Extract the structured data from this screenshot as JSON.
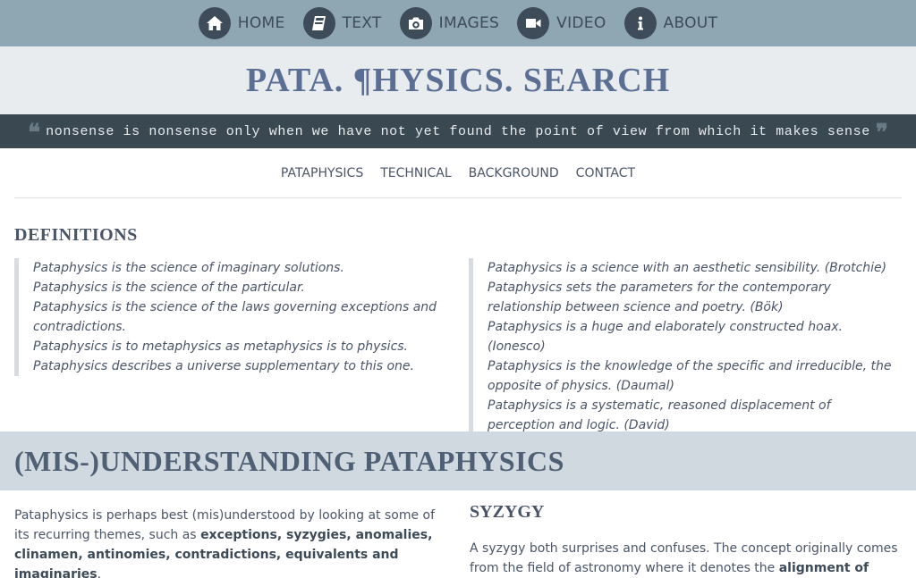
{
  "topnav": {
    "items": [
      {
        "label": "HOME",
        "icon": "home-icon"
      },
      {
        "label": "TEXT",
        "icon": "book-icon"
      },
      {
        "label": "IMAGES",
        "icon": "camera-icon"
      },
      {
        "label": "VIDEO",
        "icon": "video-camera-icon"
      },
      {
        "label": "ABOUT",
        "icon": "info-icon"
      }
    ]
  },
  "site": {
    "title": "PATA. ¶HYSICS. SEARCH"
  },
  "quote": {
    "text": "nonsense is nonsense only when we have not yet found the point of view from which it makes sense",
    "open": "❝",
    "close": "❞"
  },
  "subnav": {
    "items": [
      "PATAPHYSICS",
      "TECHNICAL",
      "BACKGROUND",
      "CONTACT"
    ]
  },
  "definitions": {
    "heading": "DEFINITIONS",
    "left": [
      "Pataphysics is the science of imaginary solutions.",
      "Pataphysics is the science of the particular.",
      "Pataphysics is the science of the laws governing exceptions and contradictions.",
      "Pataphysics is to metaphysics as metaphysics is to physics.",
      "Pataphysics describes a universe supplementary to this one."
    ],
    "right": [
      "Pataphysics is a science with an aesthetic sensibility. (Brotchie)",
      "Pataphysics sets the parameters for the contemporary relationship between science and poetry. (Bök)",
      "Pataphysics is a huge and elaborately constructed hoax. (Ionesco)",
      "Pataphysics is the knowledge of the specific and irreducible, the opposite of physics. (Daumal)",
      "Pataphysics is a systematic, reasoned displacement of perception and logic. (David)"
    ]
  },
  "misunderstanding": {
    "heading": "(MIS-)UNDERSTANDING PATAPHYSICS",
    "intro_plain": "Pataphysics is perhaps best (mis)understood by looking at some of its recurring themes, such as ",
    "intro_bold": "exceptions, syzygies, anomalies, clinamen, antinomies, contradictions, equivalents and imaginaries",
    "intro_end": "."
  },
  "syzygy": {
    "heading": "SYZYGY",
    "text_plain": "A syzygy both surprises and confuses. The concept originally comes from the field of astronomy where it denotes the ",
    "text_bold": "alignment of three celestial bodies",
    "text_end": "."
  },
  "colors": {
    "topnav_bg": "#8fa6b3",
    "icon_bg": "#3d4c58",
    "title_bg": "#e8ecef",
    "title_text": "#5a6f93",
    "quote_bg": "#3a4852",
    "band_bg": "#d0d9df"
  }
}
